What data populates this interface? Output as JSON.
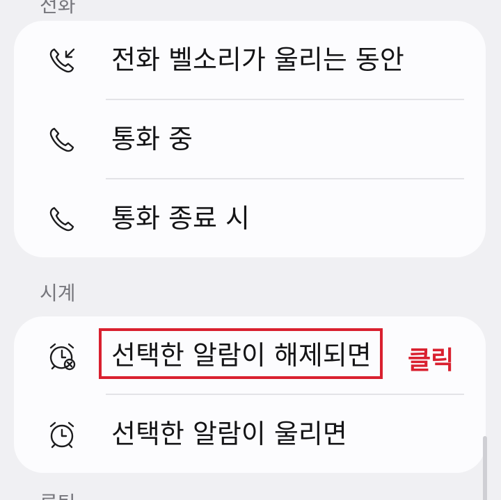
{
  "sections": {
    "phone": {
      "header": "전화",
      "items": [
        {
          "label": "전화 벨소리가 울리는 동안",
          "icon": "incoming-call-icon"
        },
        {
          "label": "통화 중",
          "icon": "phone-icon"
        },
        {
          "label": "통화 종료 시",
          "icon": "phone-icon"
        }
      ]
    },
    "clock": {
      "header": "시계",
      "items": [
        {
          "label": "선택한 알람이 해제되면",
          "icon": "alarm-dismiss-icon"
        },
        {
          "label": "선택한 알람이 울리면",
          "icon": "alarm-icon"
        }
      ]
    },
    "next": {
      "header": "루틴"
    }
  },
  "annotation": {
    "click_label": "클릭",
    "color": "#d9202f"
  }
}
